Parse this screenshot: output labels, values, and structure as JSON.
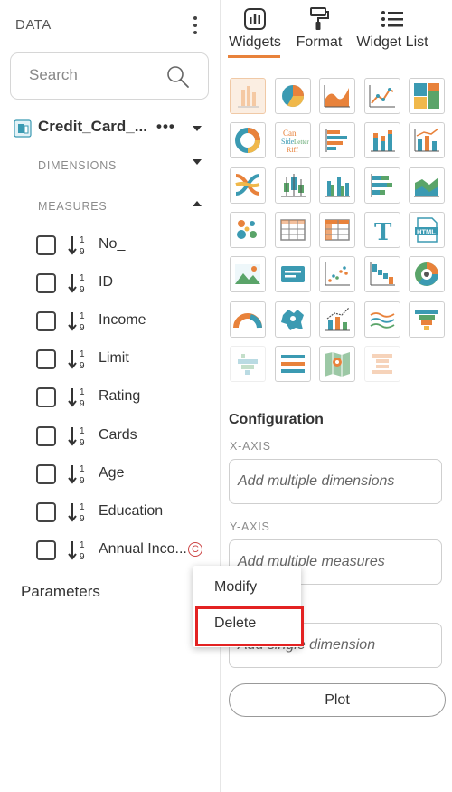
{
  "data_panel": {
    "title": "DATA",
    "search": {
      "placeholder": "Search",
      "value": ""
    },
    "dataset": {
      "name": "Credit_Card_...",
      "more": "•••"
    },
    "sections": {
      "dimensions": "DIMENSIONS",
      "measures": "MEASURES"
    },
    "measures": [
      {
        "label": "No_"
      },
      {
        "label": "ID"
      },
      {
        "label": "Income"
      },
      {
        "label": "Limit"
      },
      {
        "label": "Rating"
      },
      {
        "label": "Cards"
      },
      {
        "label": "Age"
      },
      {
        "label": "Education"
      },
      {
        "label": "Annual Inco...",
        "badge": "C"
      }
    ],
    "parameters": "Parameters",
    "number_icon_text": {
      "top": "1",
      "bottom": "9"
    }
  },
  "tabs": [
    {
      "label": "Widgets",
      "icon": "widgets-icon",
      "active": true
    },
    {
      "label": "Format",
      "icon": "format-paint-icon",
      "active": false
    },
    {
      "label": "Widget List",
      "icon": "list-icon",
      "active": false
    }
  ],
  "widgets": [
    "bar-chart-icon",
    "pie-chart-icon",
    "area-chart-icon",
    "line-chart-icon",
    "treemap-icon",
    "donut-chart-icon",
    "word-cloud-icon",
    "horizontal-bar-icon",
    "stacked-bar-icon",
    "bar-line-combo-icon",
    "sankey-icon",
    "box-plot-icon",
    "grouped-bar-icon",
    "stacked-horizontal-bar-icon",
    "stacked-area-icon",
    "bubble-icon",
    "table-icon",
    "pivot-table-icon",
    "text-icon",
    "html-icon",
    "image-icon",
    "kpi-card-icon",
    "scatter-icon",
    "waterfall-icon",
    "sunburst-icon",
    "gauge-icon",
    "map-icon",
    "bar-trend-icon",
    "multi-line-icon",
    "funnel-icon",
    "pyramid-icon",
    "progress-bar-icon",
    "geo-map-icon",
    "hourglass-icon"
  ],
  "word_cloud_text": {
    "can": "Can",
    "side": "Side",
    "letter": "Letter",
    "riff": "Riff"
  },
  "text_widget_letter": "T",
  "html_widget_text": "HTML",
  "configuration": {
    "title": "Configuration",
    "x_axis": {
      "label": "X-AXIS",
      "placeholder": "Add multiple dimensions"
    },
    "y_axis": {
      "label": "Y-AXIS",
      "placeholder": "Add multiple measures"
    },
    "third": {
      "placeholder": "Add single dimension"
    },
    "plot_label": "Plot"
  },
  "context_menu": {
    "items": [
      "Modify",
      "Delete"
    ],
    "highlighted": "Delete"
  },
  "colors": {
    "accent": "#e8823b",
    "teal": "#3b9ab2",
    "green": "#5aa469",
    "highlight_border": "#e32222"
  }
}
